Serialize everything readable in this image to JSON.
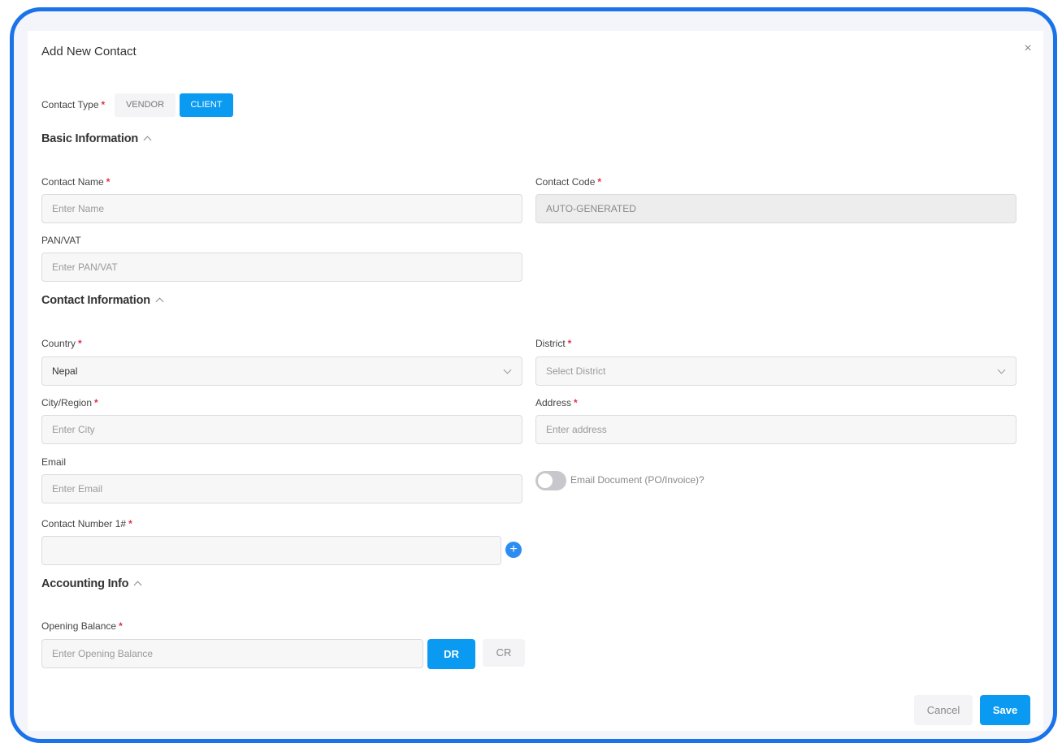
{
  "modal": {
    "title": "Add New Contact"
  },
  "contact_type": {
    "label": "Contact Type",
    "options": [
      "VENDOR",
      "CLIENT"
    ],
    "selected": "CLIENT"
  },
  "sections": {
    "basic": "Basic Information",
    "contact": "Contact Information",
    "accounting": "Accounting Info"
  },
  "fields": {
    "contact_name": {
      "label": "Contact Name",
      "placeholder": "Enter Name"
    },
    "contact_code": {
      "label": "Contact Code",
      "value": "AUTO-GENERATED"
    },
    "pan_vat": {
      "label": "PAN/VAT",
      "placeholder": "Enter PAN/VAT"
    },
    "country": {
      "label": "Country",
      "value": "Nepal"
    },
    "district": {
      "label": "District",
      "placeholder": "Select District"
    },
    "city": {
      "label": "City/Region",
      "placeholder": "Enter City"
    },
    "address": {
      "label": "Address",
      "placeholder": "Enter address"
    },
    "email": {
      "label": "Email",
      "placeholder": "Enter Email"
    },
    "email_doc_toggle": {
      "label": "Email Document (PO/Invoice)?",
      "on": false
    },
    "contact_number": {
      "label": "Contact Number 1#",
      "value": ""
    },
    "opening_balance": {
      "label": "Opening Balance",
      "placeholder": "Enter Opening Balance",
      "dr": "DR",
      "cr": "CR",
      "selected": "DR"
    }
  },
  "footer": {
    "cancel": "Cancel",
    "save": "Save"
  },
  "colors": {
    "accent": "#0a9af1",
    "frame": "#1a73e8",
    "required": "#e02f4a"
  }
}
